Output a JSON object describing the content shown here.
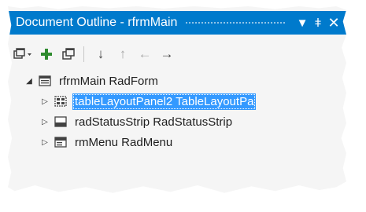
{
  "window": {
    "title": "Document Outline - rfrmMain",
    "menu_glyph": "▼",
    "pin_glyph": "ǂ",
    "close_glyph": "✕"
  },
  "toolbar": {
    "items": [
      {
        "name": "collapse-all",
        "icon": "window-dropdown-icon"
      },
      {
        "name": "add",
        "icon": "plus-icon",
        "color": "#2e8b2e"
      },
      {
        "name": "restore",
        "icon": "windows-icon"
      },
      {
        "name": "move-down",
        "glyph": "↓"
      },
      {
        "name": "move-up",
        "glyph": "↑"
      },
      {
        "name": "move-out",
        "glyph": "←"
      },
      {
        "name": "move-in",
        "glyph": "→"
      }
    ]
  },
  "tree": {
    "root": {
      "label": "rfrmMain  RadForm",
      "expander": "◢",
      "icon": "form-icon"
    },
    "children": [
      {
        "label": "tableLayoutPanel2  TableLayoutPa",
        "expander": "▷",
        "icon": "table-layout-icon",
        "selected": true
      },
      {
        "label": "radStatusStrip  RadStatusStrip",
        "expander": "▷",
        "icon": "status-strip-icon",
        "selected": false
      },
      {
        "label": "rmMenu  RadMenu",
        "expander": "▷",
        "icon": "menu-icon",
        "selected": false
      }
    ]
  },
  "colors": {
    "accent": "#007acc",
    "selection": "#3399ff",
    "background": "#f5f5f5"
  }
}
